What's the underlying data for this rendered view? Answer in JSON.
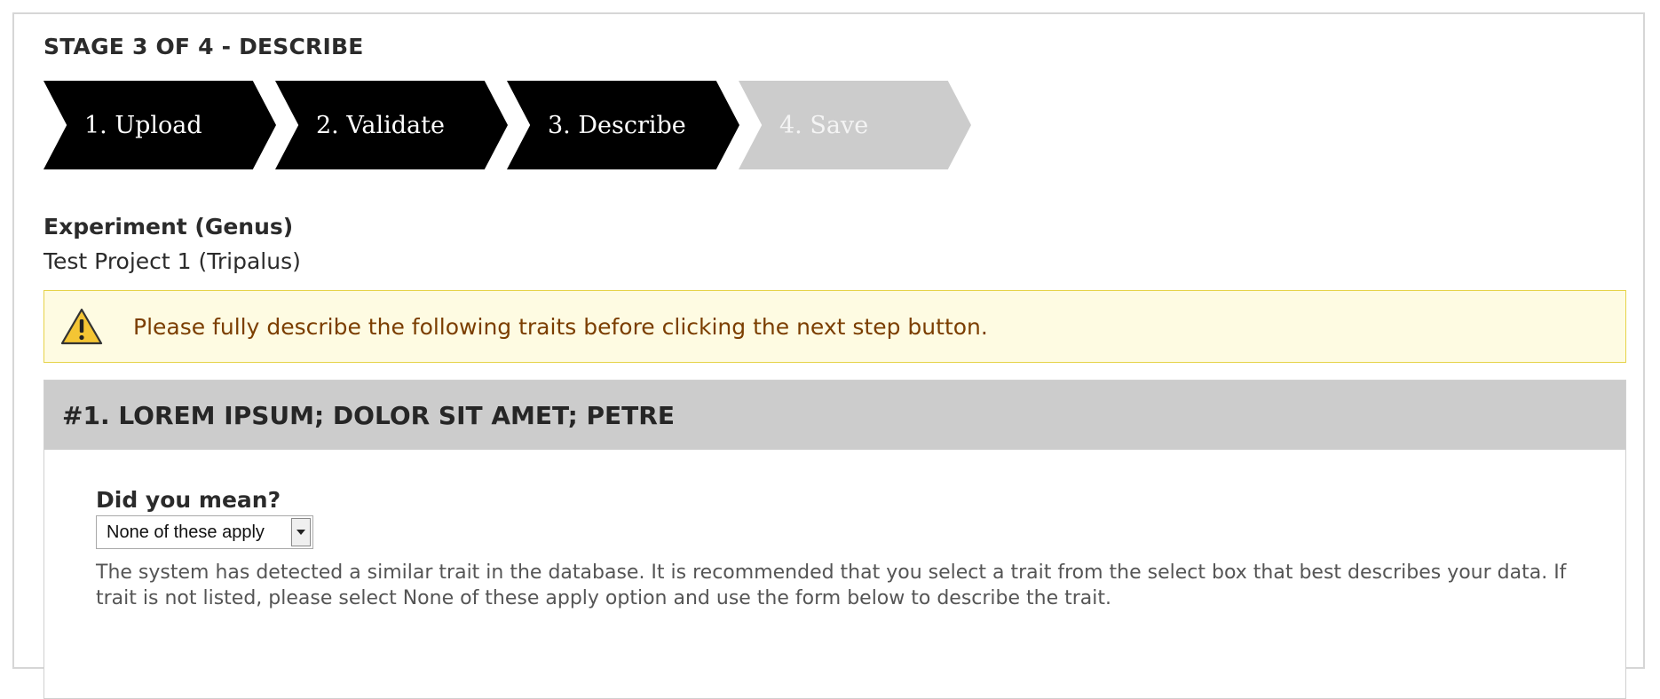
{
  "stage_title": "STAGE 3 OF 4 - DESCRIBE",
  "steps": [
    {
      "label": "1. Upload",
      "state": "completed"
    },
    {
      "label": "2. Validate",
      "state": "completed"
    },
    {
      "label": "3. Describe",
      "state": "current"
    },
    {
      "label": "4. Save",
      "state": "pending"
    }
  ],
  "experiment": {
    "label": "Experiment (Genus)",
    "value": "Test Project 1 (Tripalus)"
  },
  "warning": {
    "icon": "warning-triangle-icon",
    "text": "Please fully describe the following traits before clicking the next step button."
  },
  "trait": {
    "header": "#1. LOREM IPSUM; DOLOR SIT AMET; PETRE",
    "did_you_mean_label": "Did you mean?",
    "select_value": "None of these apply",
    "help_text": "The system has detected a similar trait in the database. It is recommended that you select a trait from the select box that best describes your data. If trait is not listed, please select None of these apply option and use the form below to describe the trait."
  },
  "colors": {
    "step_active": "#000000",
    "step_pending": "#cccccc",
    "warning_bg": "#fefbe2",
    "warning_border": "#e6d34a",
    "warning_text": "#7b3e00",
    "trait_header_bg": "#cccccc"
  }
}
